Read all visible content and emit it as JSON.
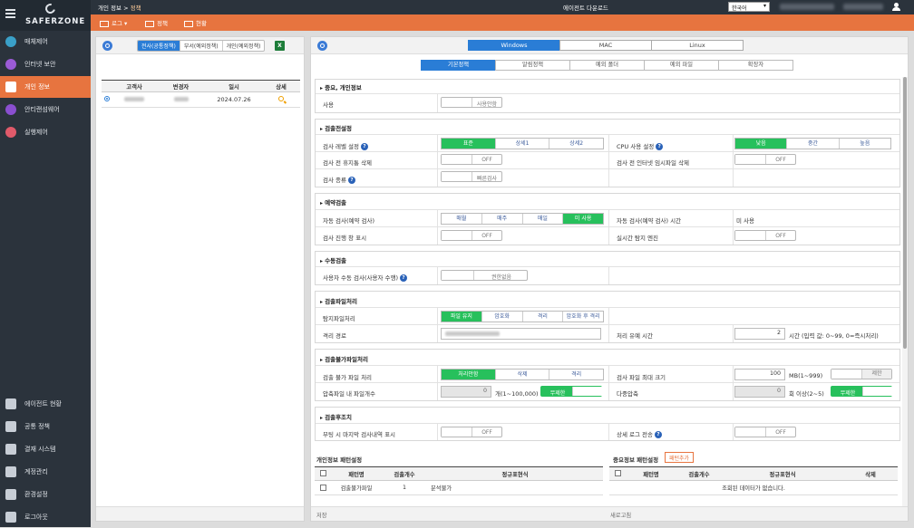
{
  "brand": {
    "name": "SAFERZONE"
  },
  "sidebar": {
    "top_items": [
      {
        "label": "매체제어",
        "icon": "media-shield-icon"
      },
      {
        "label": "인터넷 보안",
        "icon": "internet-security-icon"
      },
      {
        "label": "개인 정보",
        "icon": "privacy-icon"
      },
      {
        "label": "안티랜섬웨어",
        "icon": "anti-ransomware-icon"
      },
      {
        "label": "실행제어",
        "icon": "execution-control-icon"
      }
    ],
    "bottom_items": [
      {
        "label": "에이전트 현황",
        "icon": "agent-status-icon"
      },
      {
        "label": "공통 정책",
        "icon": "common-policy-icon"
      },
      {
        "label": "결재 시스템",
        "icon": "approval-icon"
      },
      {
        "label": "계정관리",
        "icon": "account-icon"
      },
      {
        "label": "환경설정",
        "icon": "settings-icon"
      },
      {
        "label": "로그아웃",
        "icon": "logout-icon"
      }
    ],
    "active": "개인 정보"
  },
  "topbar": {
    "breadcrumb_parent": "개인 정보",
    "breadcrumb_sep": " > ",
    "breadcrumb_current": "정책",
    "download": "에이전트 다운로드",
    "language": "한국어"
  },
  "toolbar": {
    "log": "로그",
    "policy": "정책",
    "status": "현황"
  },
  "left": {
    "tabs": [
      "전사(공통정책)",
      "부서(예외정책)",
      "개인(예외정책)"
    ],
    "excel_icon": "X",
    "columns": [
      "고객사",
      "변경자",
      "일시",
      "상세"
    ],
    "rows": [
      {
        "date": "2024.07.26"
      }
    ]
  },
  "right": {
    "os_tabs": [
      "Windows",
      "MAC",
      "Linux"
    ],
    "sub_tabs": [
      "기본정책",
      "알림정책",
      "예외 폴더",
      "예외 파일",
      "확장자"
    ],
    "sections": {
      "s1": {
        "title": "중요, 개인정보",
        "use_label": "사용",
        "use_value": "사용안함"
      },
      "s2": {
        "title": "검출전설정",
        "level_label": "검사 레벨 설정",
        "level_opts": [
          "표준",
          "상세1",
          "상세2"
        ],
        "cpu_label": "CPU 사용 설정",
        "cpu_opts": [
          "낮음",
          "중간",
          "높음"
        ],
        "trash_label": "검사 전 휴지통 삭제",
        "inet_label": "검사 전 인터넷 임시파일 삭제",
        "kind_label": "검사 종류",
        "kind_value": "빠른검사",
        "off": "OFF"
      },
      "s3": {
        "title": "예약검출",
        "auto_label": "자동 검사(예약 검사)",
        "auto_opts": [
          "매월",
          "매주",
          "매일",
          "미 사용"
        ],
        "time_label": "자동 검사(예약 검사) 시간",
        "time_value": "미 사용",
        "win_label": "검사 진행 창 표시",
        "rt_label": "실시간 탐지 엔진"
      },
      "s4": {
        "title": "수동검출",
        "manual_label": "사용자 수동 검사(사용자 수행)",
        "manual_value": "권한없음"
      },
      "s5": {
        "title": "검출파일처리",
        "proc_label": "탐지파일처리",
        "proc_opts": [
          "파일 유지",
          "암호화",
          "격리",
          "암호화 후 격리"
        ],
        "path_label": "격리 경로",
        "hold_label": "처리 유예 시간",
        "hold_value": "2",
        "hold_unit": "시간 (입력 값: 0~99, 0=즉시처리)"
      },
      "s6": {
        "title": "검출불가파일처리",
        "unable_label": "검출 불가 파일 처리",
        "unable_opts": [
          "처리안함",
          "삭제",
          "격리"
        ],
        "maxsize_label": "검사 파일 최대 크기",
        "maxsize_value": "100",
        "maxsize_unit": "MB(1~999)",
        "maxsize_toggle": "제한",
        "zip_label": "압축파일 내 파일개수",
        "zip_value": "0",
        "zip_unit": "개(1~100,000)",
        "zip_toggle": "무제한",
        "multi_label": "다중압축",
        "multi_value": "0",
        "multi_unit": "회 이상(2~5)",
        "multi_toggle": "무제한"
      },
      "s7": {
        "title": "검출후조치",
        "boot_label": "부팅 시 마지막 검사내역 표시",
        "log_label": "상세 로그 전송"
      }
    },
    "pattern_left": {
      "title": "개인정보 패턴설정",
      "columns": [
        "패턴명",
        "검출개수",
        "정규표현식"
      ],
      "rows": [
        {
          "name": "검출불가파일",
          "count": "1",
          "regex": "분석불가"
        }
      ]
    },
    "pattern_right": {
      "title": "중요정보 패턴설정",
      "add_button": "패턴추가",
      "columns": [
        "패턴명",
        "검출개수",
        "정규표현식",
        "삭제"
      ],
      "empty": "조회된 데이터가 없습니다."
    },
    "footer": {
      "save": "저장",
      "refresh": "새로고침"
    }
  },
  "colors": {
    "accent": "#e7743f",
    "sidebar": "#2b333c",
    "primary": "#2a7dd6",
    "on": "#27c05c"
  }
}
